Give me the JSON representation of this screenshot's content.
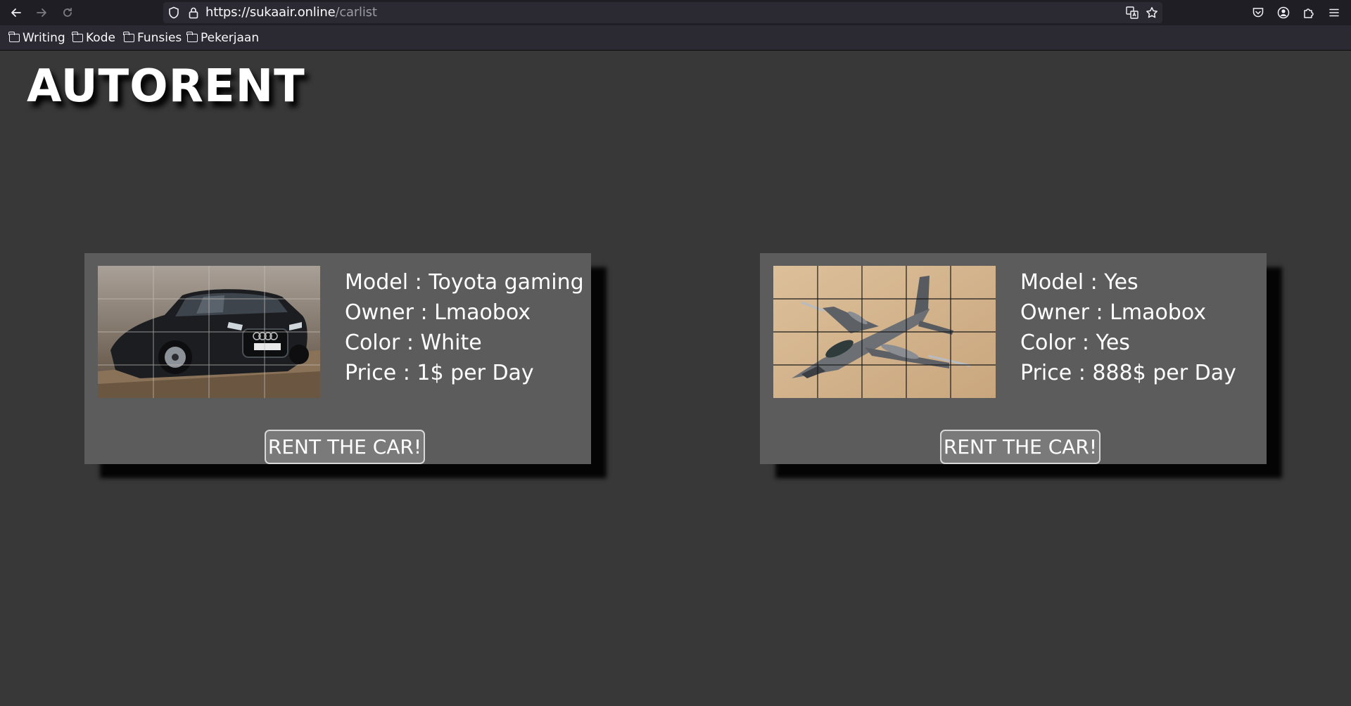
{
  "browser": {
    "url_host": "https://sukaair.online",
    "url_path": "/carlist",
    "bookmarks": [
      "Writing",
      "Kode",
      "Funsies",
      "Pekerjaan"
    ]
  },
  "page": {
    "brand": "AUTORENT",
    "colors": {
      "background": "#383838",
      "card": "#5c5c5c",
      "button": "#7a7a7a"
    },
    "listings": [
      {
        "image_icon": "car-photo",
        "model": "Model : Toyota gaming",
        "owner": "Owner : Lmaobox",
        "color": "Color : White",
        "price": "Price : 1$ per Day",
        "button": "RENT THE CAR!"
      },
      {
        "image_icon": "fighter-jet-photo",
        "model": "Model : Yes",
        "owner": "Owner : Lmaobox",
        "color": "Color : Yes",
        "price": "Price : 888$ per Day",
        "button": "RENT THE CAR!"
      }
    ]
  }
}
